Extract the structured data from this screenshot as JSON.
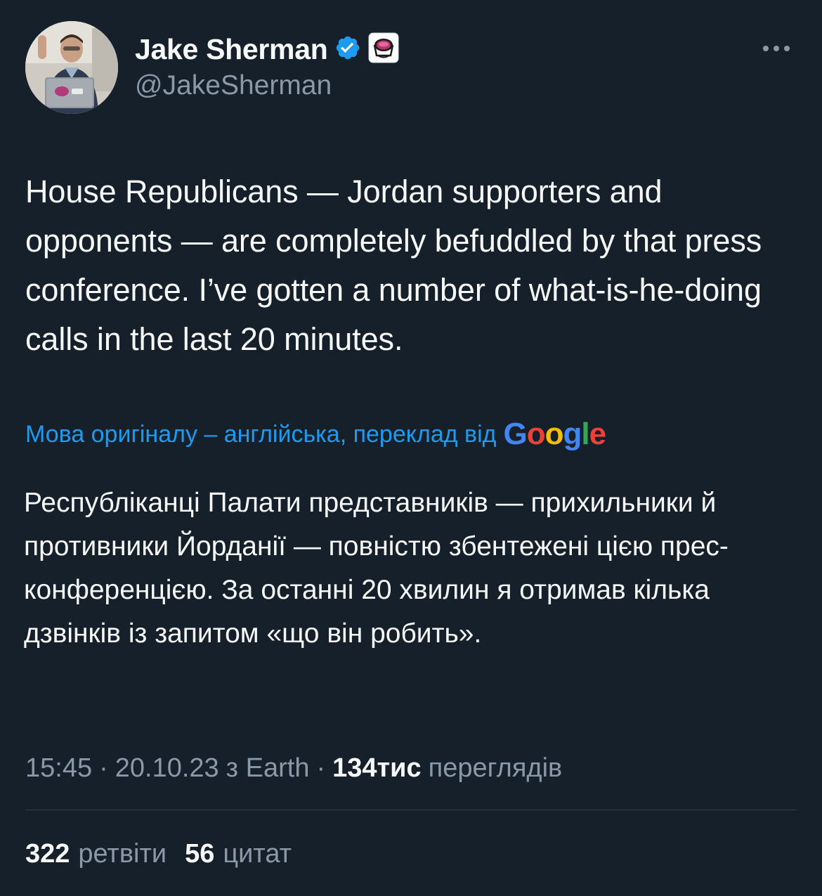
{
  "theme": {
    "background": "#15202b",
    "text": "#f7f9f9",
    "secondary_text": "#8b98a5",
    "link": "#1d9bf0",
    "divider": "#38444d",
    "verified_badge": "#1d9bf0"
  },
  "author": {
    "name": "Jake Sherman",
    "handle": "@JakeSherman",
    "avatar_icon": "user-avatar",
    "verified_icon": "verified-badge-icon",
    "affiliate_icon": "affiliate-badge-icon"
  },
  "header": {
    "more_icon": "more-horizontal-icon"
  },
  "tweet": {
    "text": "House Republicans — Jordan supporters and opponents — are completely befuddled by that press conference. I’ve gotten a number of what-is-he-doing calls in the last 20 minutes.",
    "translation_label": "Мова оригіналу – англійська, переклад від",
    "translation_provider": "Google",
    "translated_text": "Республіканці Палати представників — прихильники й противники Йорданії — повністю збентежені цією прес-конференцією. За останні 20 хвилин я отримав кілька дзвінків із запитом «що він робить»."
  },
  "meta": {
    "time": "15:45",
    "separator": "·",
    "date": "20.10.23",
    "source": "з Earth",
    "views_count": "134тис",
    "views_label": "переглядів"
  },
  "stats": {
    "retweets_count": "322",
    "retweets_label": "ретвіти",
    "quotes_count": "56",
    "quotes_label": "цитат"
  }
}
